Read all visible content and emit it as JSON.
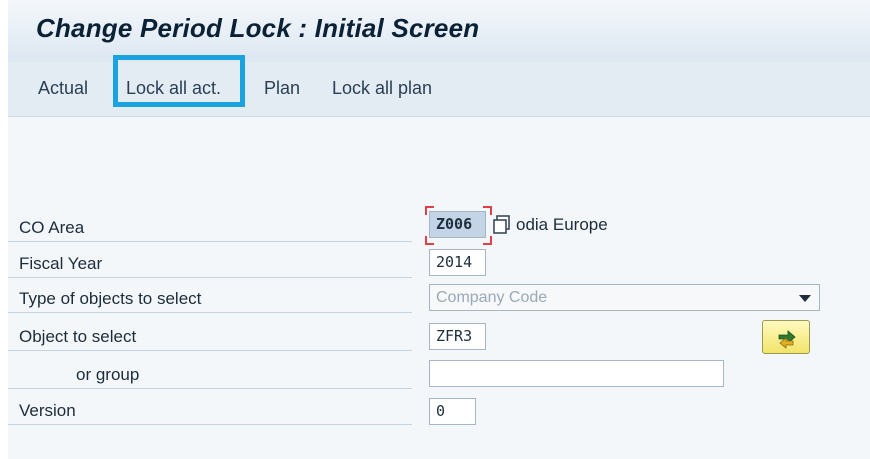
{
  "window": {
    "title": "Change Period Lock : Initial Screen"
  },
  "toolbar": {
    "items": [
      {
        "label": "Actual"
      },
      {
        "label": "Lock all act."
      },
      {
        "label": "Plan"
      },
      {
        "label": "Lock all plan"
      }
    ]
  },
  "form": {
    "co_area": {
      "label": "CO Area",
      "value": "Z006",
      "description": "odia Europe"
    },
    "fiscal_year": {
      "label": "Fiscal Year",
      "value": "2014"
    },
    "type_of_objects": {
      "label": "Type of objects to select",
      "value": "Company Code"
    },
    "object_to_select": {
      "label": "Object to select",
      "value": "ZFR3"
    },
    "or_group": {
      "label": "or group",
      "value": ""
    },
    "version": {
      "label": "Version",
      "value": "0"
    }
  },
  "icons": {
    "matchcode": "copy-icon",
    "execute": "arrow-exchange-icon"
  },
  "colors": {
    "highlight_border": "#1aa3e0",
    "title_text": "#0b2136",
    "required_marker": "#e04048"
  }
}
